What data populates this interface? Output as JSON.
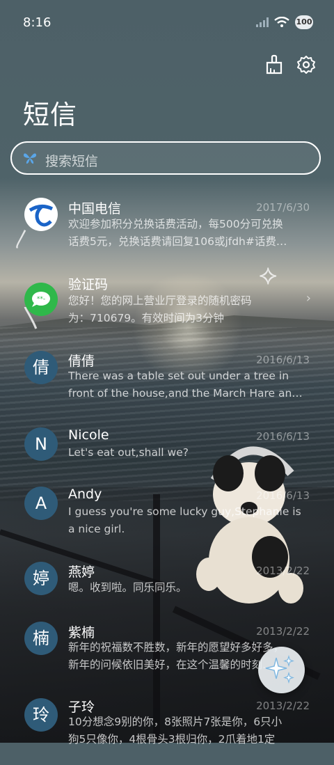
{
  "status_bar": {
    "time": "8:16",
    "battery": "100"
  },
  "header": {
    "title": "短信"
  },
  "search": {
    "placeholder": "搜索短信"
  },
  "conversations": [
    {
      "name": "中国电信",
      "date": "2017/6/30",
      "line1": "欢迎参加积分兑换话费活动，每500分可兑换",
      "line2": "话费5元，兑换话费请回复106或jfdh#话费…"
    },
    {
      "name": "验证码",
      "date": "",
      "line1": "您好！您的网上营业厅登录的随机密码",
      "line2": "为：710679。有效时间为3分钟"
    },
    {
      "avatar": "倩",
      "name": "倩倩",
      "date": "2016/6/13",
      "line1": "There was a table set out under a tree in",
      "line2": "front of the house,and the March Hare an…"
    },
    {
      "avatar": "N",
      "name": "Nicole",
      "date": "2016/6/13",
      "line1": "Let's eat out,shall we?",
      "line2": ""
    },
    {
      "avatar": "A",
      "name": "Andy",
      "date": "2016/6/13",
      "line1": "I guess you're some lucky guy,Stephanie is",
      "line2": "a nice girl."
    },
    {
      "avatar": "婷",
      "name": "燕婷",
      "date": "2013/2/22",
      "line1": "嗯。收到啦。同乐同乐。",
      "line2": ""
    },
    {
      "avatar": "楠",
      "name": "紫楠",
      "date": "2013/2/22",
      "line1": "新年的祝福数不胜数，新年的愿望好多好多，",
      "line2": "新年的问候依旧美好，在这个温馨的时刻…"
    },
    {
      "avatar": "玲",
      "name": "子玲",
      "date": "2013/2/22",
      "line1": "10分想念9别的你，8张照片7张是你，6只小",
      "line2": "狗5只像你，4根骨头3根归你，2爪着地1定"
    }
  ],
  "colors": {
    "avatar_bg": "#2f5b78",
    "telecom_blue": "#1a64c8",
    "verify_green": "#2fb84a"
  }
}
